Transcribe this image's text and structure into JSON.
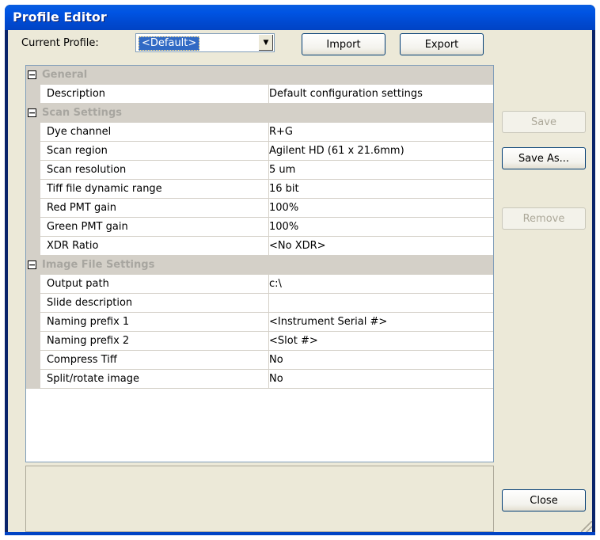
{
  "window": {
    "title": "Profile Editor"
  },
  "profile": {
    "label": "Current Profile:",
    "selected": "<Default>",
    "import_label": "Import",
    "export_label": "Export"
  },
  "actions": {
    "save_label": "Save",
    "save_as_label": "Save As...",
    "remove_label": "Remove",
    "close_label": "Close"
  },
  "grid": {
    "categories": {
      "general": "General",
      "scan": "Scan Settings",
      "image": "Image File Settings"
    },
    "general": [
      {
        "name": "Description",
        "value": "Default configuration settings"
      }
    ],
    "scan": [
      {
        "name": "Dye channel",
        "value": "R+G"
      },
      {
        "name": "Scan region",
        "value": "Agilent HD (61 x 21.6mm)"
      },
      {
        "name": "Scan resolution",
        "value": "5 um"
      },
      {
        "name": "Tiff file dynamic range",
        "value": "16 bit"
      },
      {
        "name": "Red PMT gain",
        "value": "100%"
      },
      {
        "name": "Green PMT gain",
        "value": "100%"
      },
      {
        "name": "XDR Ratio",
        "value": "<No XDR>"
      }
    ],
    "image": [
      {
        "name": "Output path",
        "value": "c:\\"
      },
      {
        "name": "Slide description",
        "value": ""
      },
      {
        "name": "Naming prefix 1",
        "value": "<Instrument Serial #>"
      },
      {
        "name": "Naming prefix 2",
        "value": "<Slot #>"
      },
      {
        "name": "Compress Tiff",
        "value": "No"
      },
      {
        "name": "Split/rotate image",
        "value": "No"
      }
    ],
    "expand_glyph": "−"
  },
  "icons": {
    "dropdown": "dropdown-arrow-icon",
    "collapse": "collapse-box-icon"
  }
}
